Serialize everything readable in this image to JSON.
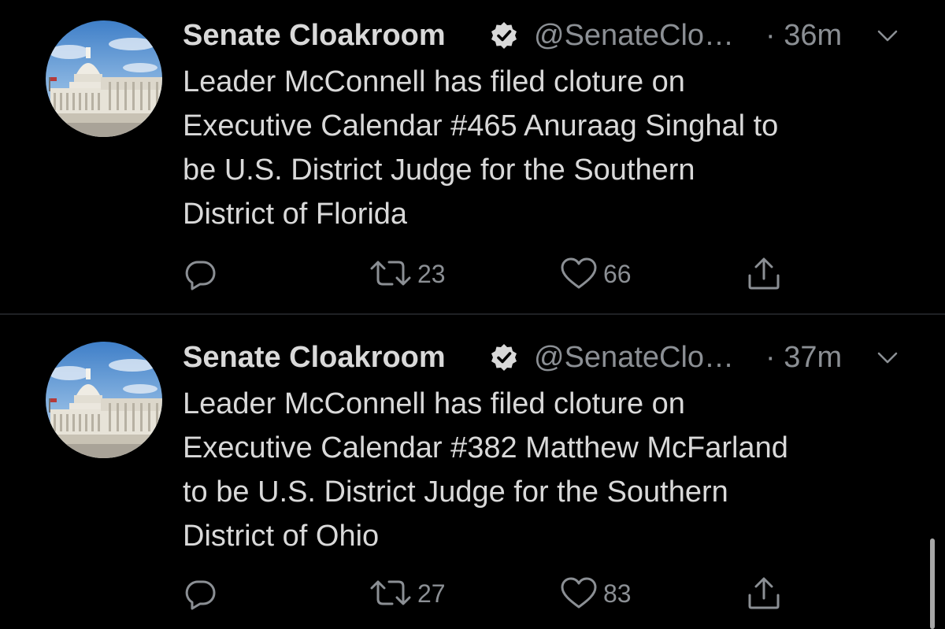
{
  "tweets": [
    {
      "name": "Senate Cloakroom",
      "handle": "@SenateClo…",
      "time": "· 36m",
      "text": "Leader McConnell has filed cloture on\nExecutive Calendar #465 Anuraag Singhal to\nbe U.S. District Judge for the Southern\nDistrict of Florida",
      "retweets": "23",
      "likes": "66"
    },
    {
      "name": "Senate Cloakroom",
      "handle": "@SenateClo…",
      "time": "· 37m",
      "text": "Leader McConnell has filed cloture on\nExecutive Calendar #382 Matthew McFarland\nto be U.S. District Judge for the Southern\nDistrict of Ohio",
      "retweets": "27",
      "likes": "83"
    }
  ],
  "icons": {
    "avatar": "capitol-building-avatar",
    "verified": "verified-badge-icon",
    "caret": "chevron-down-icon",
    "reply": "reply-icon",
    "retweet": "retweet-icon",
    "like": "heart-icon",
    "share": "share-icon"
  },
  "colors": {
    "background": "#000000",
    "primary_text": "#d9d9d9",
    "secondary_text": "#8b8f94",
    "divider": "#1f2124",
    "verified_badge": "#d9d9d9"
  }
}
